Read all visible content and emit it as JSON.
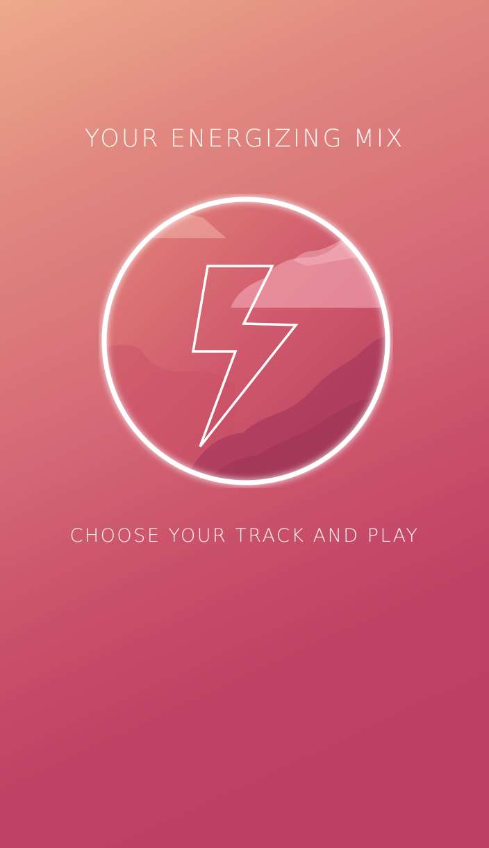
{
  "screen": {
    "title": "YOUR ENERGIZING MIX",
    "subtitle": "CHOOSE YOUR TRACK AND PLAY"
  },
  "badge": {
    "icon": "lightning-bolt-icon",
    "ring_color": "#ffffff"
  },
  "theme": {
    "gradient_start": "#edaa8c",
    "gradient_end": "#bd4063"
  }
}
